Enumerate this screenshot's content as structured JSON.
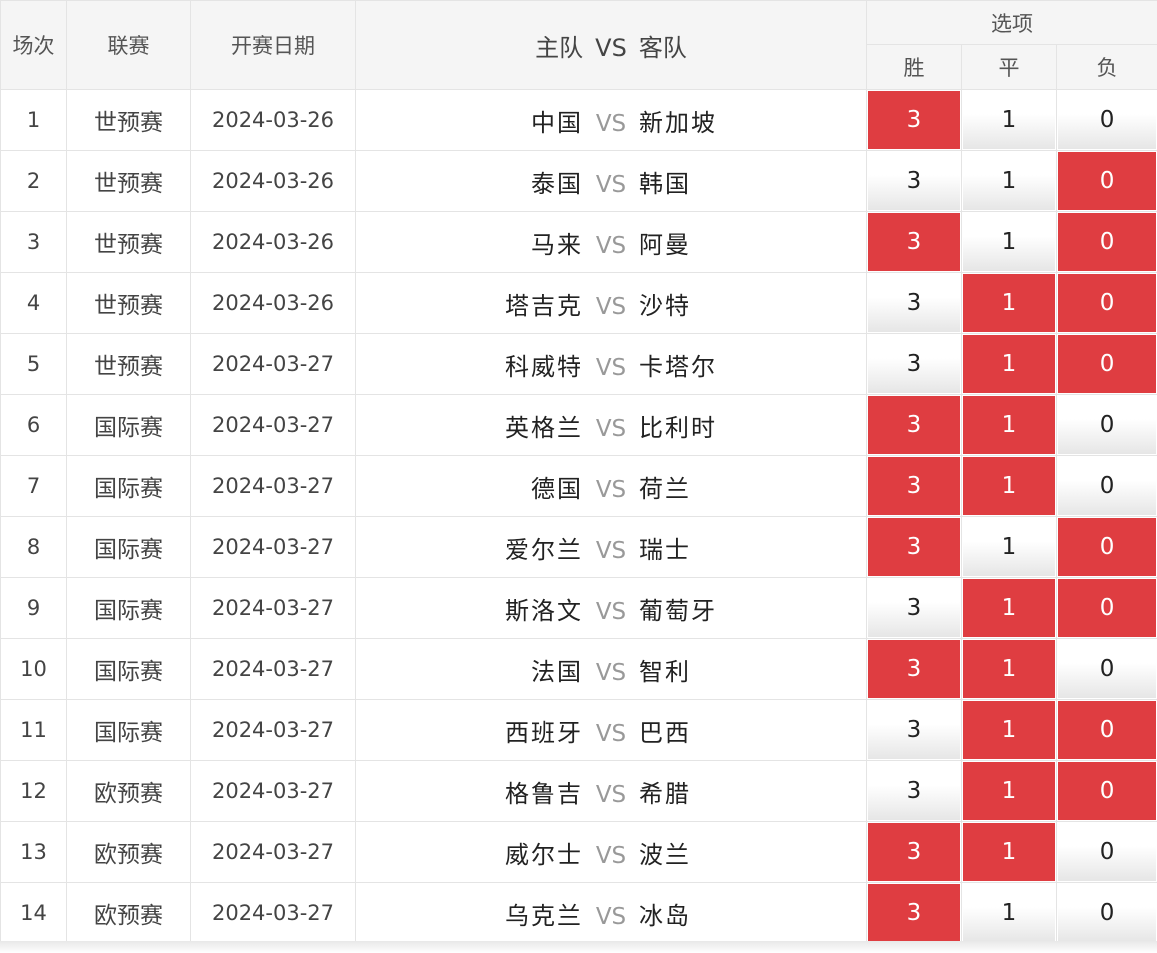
{
  "header": {
    "idx": "场次",
    "league": "联赛",
    "date": "开赛日期",
    "home": "主队",
    "vs": "VS",
    "away": "客队",
    "options": "选项",
    "win": "胜",
    "draw": "平",
    "lose": "负"
  },
  "rows": [
    {
      "idx": "1",
      "league": "世预赛",
      "date": "2024-03-26",
      "home": "中国",
      "away": "新加坡",
      "win": "3",
      "draw": "1",
      "lose": "0",
      "sel": [
        true,
        false,
        false
      ]
    },
    {
      "idx": "2",
      "league": "世预赛",
      "date": "2024-03-26",
      "home": "泰国",
      "away": "韩国",
      "win": "3",
      "draw": "1",
      "lose": "0",
      "sel": [
        false,
        false,
        true
      ]
    },
    {
      "idx": "3",
      "league": "世预赛",
      "date": "2024-03-26",
      "home": "马来",
      "away": "阿曼",
      "win": "3",
      "draw": "1",
      "lose": "0",
      "sel": [
        true,
        false,
        true
      ]
    },
    {
      "idx": "4",
      "league": "世预赛",
      "date": "2024-03-26",
      "home": "塔吉克",
      "away": "沙特",
      "win": "3",
      "draw": "1",
      "lose": "0",
      "sel": [
        false,
        true,
        true
      ]
    },
    {
      "idx": "5",
      "league": "世预赛",
      "date": "2024-03-27",
      "home": "科威特",
      "away": "卡塔尔",
      "win": "3",
      "draw": "1",
      "lose": "0",
      "sel": [
        false,
        true,
        true
      ]
    },
    {
      "idx": "6",
      "league": "国际赛",
      "date": "2024-03-27",
      "home": "英格兰",
      "away": "比利时",
      "win": "3",
      "draw": "1",
      "lose": "0",
      "sel": [
        true,
        true,
        false
      ]
    },
    {
      "idx": "7",
      "league": "国际赛",
      "date": "2024-03-27",
      "home": "德国",
      "away": "荷兰",
      "win": "3",
      "draw": "1",
      "lose": "0",
      "sel": [
        true,
        true,
        false
      ]
    },
    {
      "idx": "8",
      "league": "国际赛",
      "date": "2024-03-27",
      "home": "爱尔兰",
      "away": "瑞士",
      "win": "3",
      "draw": "1",
      "lose": "0",
      "sel": [
        true,
        false,
        true
      ]
    },
    {
      "idx": "9",
      "league": "国际赛",
      "date": "2024-03-27",
      "home": "斯洛文",
      "away": "葡萄牙",
      "win": "3",
      "draw": "1",
      "lose": "0",
      "sel": [
        false,
        true,
        true
      ]
    },
    {
      "idx": "10",
      "league": "国际赛",
      "date": "2024-03-27",
      "home": "法国",
      "away": "智利",
      "win": "3",
      "draw": "1",
      "lose": "0",
      "sel": [
        true,
        true,
        false
      ]
    },
    {
      "idx": "11",
      "league": "国际赛",
      "date": "2024-03-27",
      "home": "西班牙",
      "away": "巴西",
      "win": "3",
      "draw": "1",
      "lose": "0",
      "sel": [
        false,
        true,
        true
      ]
    },
    {
      "idx": "12",
      "league": "欧预赛",
      "date": "2024-03-27",
      "home": "格鲁吉",
      "away": "希腊",
      "win": "3",
      "draw": "1",
      "lose": "0",
      "sel": [
        false,
        true,
        true
      ]
    },
    {
      "idx": "13",
      "league": "欧预赛",
      "date": "2024-03-27",
      "home": "威尔士",
      "away": "波兰",
      "win": "3",
      "draw": "1",
      "lose": "0",
      "sel": [
        true,
        true,
        false
      ]
    },
    {
      "idx": "14",
      "league": "欧预赛",
      "date": "2024-03-27",
      "home": "乌克兰",
      "away": "冰岛",
      "win": "3",
      "draw": "1",
      "lose": "0",
      "sel": [
        true,
        false,
        false
      ]
    }
  ],
  "colors": {
    "selected": "#df3d41",
    "unselected": "#ffffff"
  }
}
